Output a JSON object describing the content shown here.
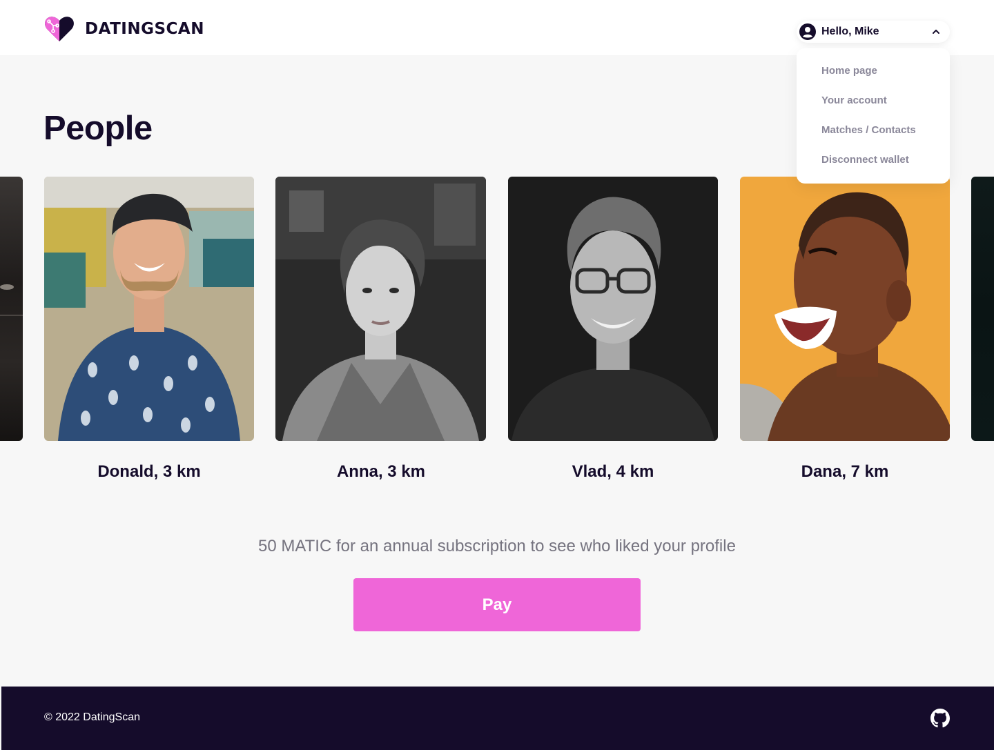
{
  "brand": {
    "name": "DATINGSCAN",
    "colors": {
      "accent": "#ef66d8",
      "dark": "#150c2b",
      "muted": "#8a8799"
    }
  },
  "header": {
    "user_greeting": "Hello, Mike",
    "menu_icon": "chevron-up-icon",
    "avatar_icon": "user-circle-icon"
  },
  "dropdown": {
    "items": [
      {
        "label": "Home page"
      },
      {
        "label": "Your account"
      },
      {
        "label": "Matches / Contacts"
      },
      {
        "label": "Disconnect wallet"
      }
    ]
  },
  "main": {
    "title": "People",
    "people": [
      {
        "label": "Donald, 3 km"
      },
      {
        "label": "Anna, 3 km"
      },
      {
        "label": "Vlad, 4 km"
      },
      {
        "label": "Dana, 7 km"
      }
    ]
  },
  "subscription": {
    "text": "50 MATIC for an annual subscription to see who liked your profile",
    "pay_label": "Pay"
  },
  "footer": {
    "copyright": "© 2022 DatingScan",
    "icon": "github-icon"
  }
}
